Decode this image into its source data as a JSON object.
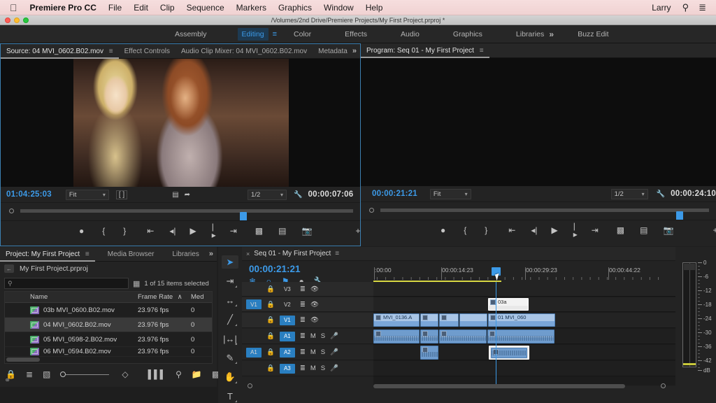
{
  "menubar": {
    "apple_icon": "apple-icon",
    "app_name": "Premiere Pro CC",
    "items": [
      "File",
      "Edit",
      "Clip",
      "Sequence",
      "Markers",
      "Graphics",
      "Window",
      "Help"
    ],
    "user": "Larry",
    "search_icon": "search-icon",
    "list_icon": "list-icon"
  },
  "titlebar": {
    "document_path": "/Volumes/2nd Drive/Premiere Projects/My First Project.prproj *"
  },
  "workspace": {
    "tabs": [
      "Assembly",
      "Editing",
      "Color",
      "Effects",
      "Audio",
      "Graphics",
      "Libraries",
      "Buzz Edit"
    ],
    "active": "Editing",
    "overflow_icon": "»"
  },
  "source_monitor": {
    "tabs": [
      "Source: 04 MVI_0602.B02.mov",
      "Effect Controls",
      "Audio Clip Mixer: 04 MVI_0602.B02.mov",
      "Metadata"
    ],
    "active_tab": "Source: 04 MVI_0602.B02.mov",
    "overflow_icon": "»",
    "current_timecode": "01:04:25:03",
    "duration_timecode": "00:00:07:06",
    "zoom_level": "Fit",
    "resolution": "1/2",
    "settings_icon": "wrench-icon",
    "transport_icons": [
      "add-marker-icon",
      "mark-in-icon",
      "mark-out-icon",
      "go-to-in-icon",
      "step-back-icon",
      "play-icon",
      "step-forward-icon",
      "go-to-out-icon",
      "insert-icon",
      "overwrite-icon",
      "export-frame-icon"
    ],
    "button_editor_icon": "+"
  },
  "program_monitor": {
    "tab": "Program: Seq 01 - My First Project",
    "current_timecode": "00:00:21:21",
    "duration_timecode": "00:00:24:10",
    "zoom_level": "Fit",
    "resolution": "1/2",
    "settings_icon": "wrench-icon",
    "button_editor_icon": "+"
  },
  "project_panel": {
    "tabs": [
      "Project: My First Project",
      "Media Browser",
      "Libraries"
    ],
    "active_tab": "Project: My First Project",
    "overflow_icon": "»",
    "breadcrumb": "My First Project.prproj",
    "search_placeholder": "",
    "search_value": "",
    "selection_status": "1 of 15 items selected",
    "columns": [
      "Name",
      "Frame Rate",
      "Med"
    ],
    "sort_indicator": "∧",
    "rows": [
      {
        "name": "03b MVI_0600.B02.mov",
        "frame_rate": "23.976 fps",
        "med": "0",
        "selected": false,
        "swatch": "blue"
      },
      {
        "name": "04 MVI_0602.B02.mov",
        "frame_rate": "23.976 fps",
        "med": "0",
        "selected": true,
        "swatch": "blue"
      },
      {
        "name": "05 MVI_0598-2.B02.mov",
        "frame_rate": "23.976 fps",
        "med": "0",
        "selected": false,
        "swatch": "blue"
      },
      {
        "name": "06 MVI_0594.B02.mov",
        "frame_rate": "23.976 fps",
        "med": "0",
        "selected": false,
        "swatch": "purple"
      }
    ],
    "toolbar_icons": [
      "lock-icon",
      "list-view-icon",
      "icon-view-icon",
      "zoom-slider",
      "sort-icon",
      "freeform-view-icon",
      "find-icon",
      "new-bin-icon",
      "new-item-icon",
      "delete-icon"
    ],
    "cc_badge": "creative-cloud-icon"
  },
  "tools_panel": {
    "tools": [
      {
        "name": "selection-tool",
        "glyph": "➤",
        "active": true
      },
      {
        "name": "track-select-forward-tool",
        "glyph": "⇥"
      },
      {
        "name": "ripple-edit-tool",
        "glyph": "↔"
      },
      {
        "name": "razor-tool",
        "glyph": "╱"
      },
      {
        "name": "slip-tool",
        "glyph": "↔"
      },
      {
        "name": "pen-tool",
        "glyph": "✒"
      },
      {
        "name": "hand-tool",
        "glyph": "✋"
      },
      {
        "name": "type-tool",
        "glyph": "T"
      }
    ]
  },
  "timeline": {
    "close_icon": "×",
    "sequence_name": "Seq 01 - My First Project",
    "burger_icon": "≡",
    "playhead_timecode": "00:00:21:21",
    "tool_icons": [
      "snap-in-timeline-icon",
      "linked-selection-icon",
      "add-marker-icon",
      "marker-icon",
      "timeline-settings-icon"
    ],
    "ruler_labels": [
      ":00:00",
      "00:00:14:23",
      "00:00:29:23",
      "00:00:44:22"
    ],
    "video_tracks": [
      {
        "label": "V3",
        "source_tag": "",
        "sync_lock": "lock-icon",
        "target": false,
        "eye": "eye-icon"
      },
      {
        "label": "V2",
        "source_tag": "V1",
        "sync_lock": "lock-icon",
        "target": false,
        "eye": "eye-icon"
      },
      {
        "label": "V1",
        "source_tag": "",
        "sync_lock": "lock-icon",
        "target": true,
        "eye": "eye-icon"
      }
    ],
    "audio_tracks": [
      {
        "label": "A1",
        "source_tag": "",
        "sync_lock": "lock-icon",
        "target": true,
        "mute": "M",
        "solo": "S",
        "mic": "mic-icon"
      },
      {
        "label": "A2",
        "source_tag": "A1",
        "sync_lock": "lock-icon",
        "target": true,
        "mute": "M",
        "solo": "S",
        "mic": "mic-icon"
      },
      {
        "label": "A3",
        "source_tag": "",
        "sync_lock": "lock-icon",
        "target": true,
        "mute": "M",
        "solo": "S",
        "mic": "mic-icon"
      }
    ],
    "clips": {
      "v2": [
        {
          "label": "03a",
          "selected": true
        }
      ],
      "v1": [
        {
          "label": "MVI_0136.A",
          "selected": false
        },
        {
          "label": "",
          "selected": false
        },
        {
          "label": "",
          "selected": false
        },
        {
          "label": "",
          "selected": false
        },
        {
          "label": "01 MVI_060",
          "selected": false
        }
      ],
      "a1": [
        {
          "label": "",
          "selected": false
        },
        {
          "label": "",
          "selected": false
        },
        {
          "label": "",
          "selected": false
        },
        {
          "label": "",
          "selected": false
        }
      ],
      "a2": [
        {
          "label": "",
          "selected": false
        },
        {
          "label": "",
          "selected": true
        }
      ]
    }
  },
  "audio_meters": {
    "scale_labels": [
      "0",
      "-6",
      "-12",
      "-18",
      "-24",
      "-30",
      "-36",
      "-42",
      "dB"
    ]
  },
  "colors": {
    "accent_blue": "#3c9ae8",
    "panel_bg": "#232323",
    "tab_bg": "#272727",
    "track_header": "#2a2a2a",
    "clip_blue": "#7aa6d8",
    "work_area_yellow": "#d7d742",
    "lock_green": "#3ea34b"
  }
}
